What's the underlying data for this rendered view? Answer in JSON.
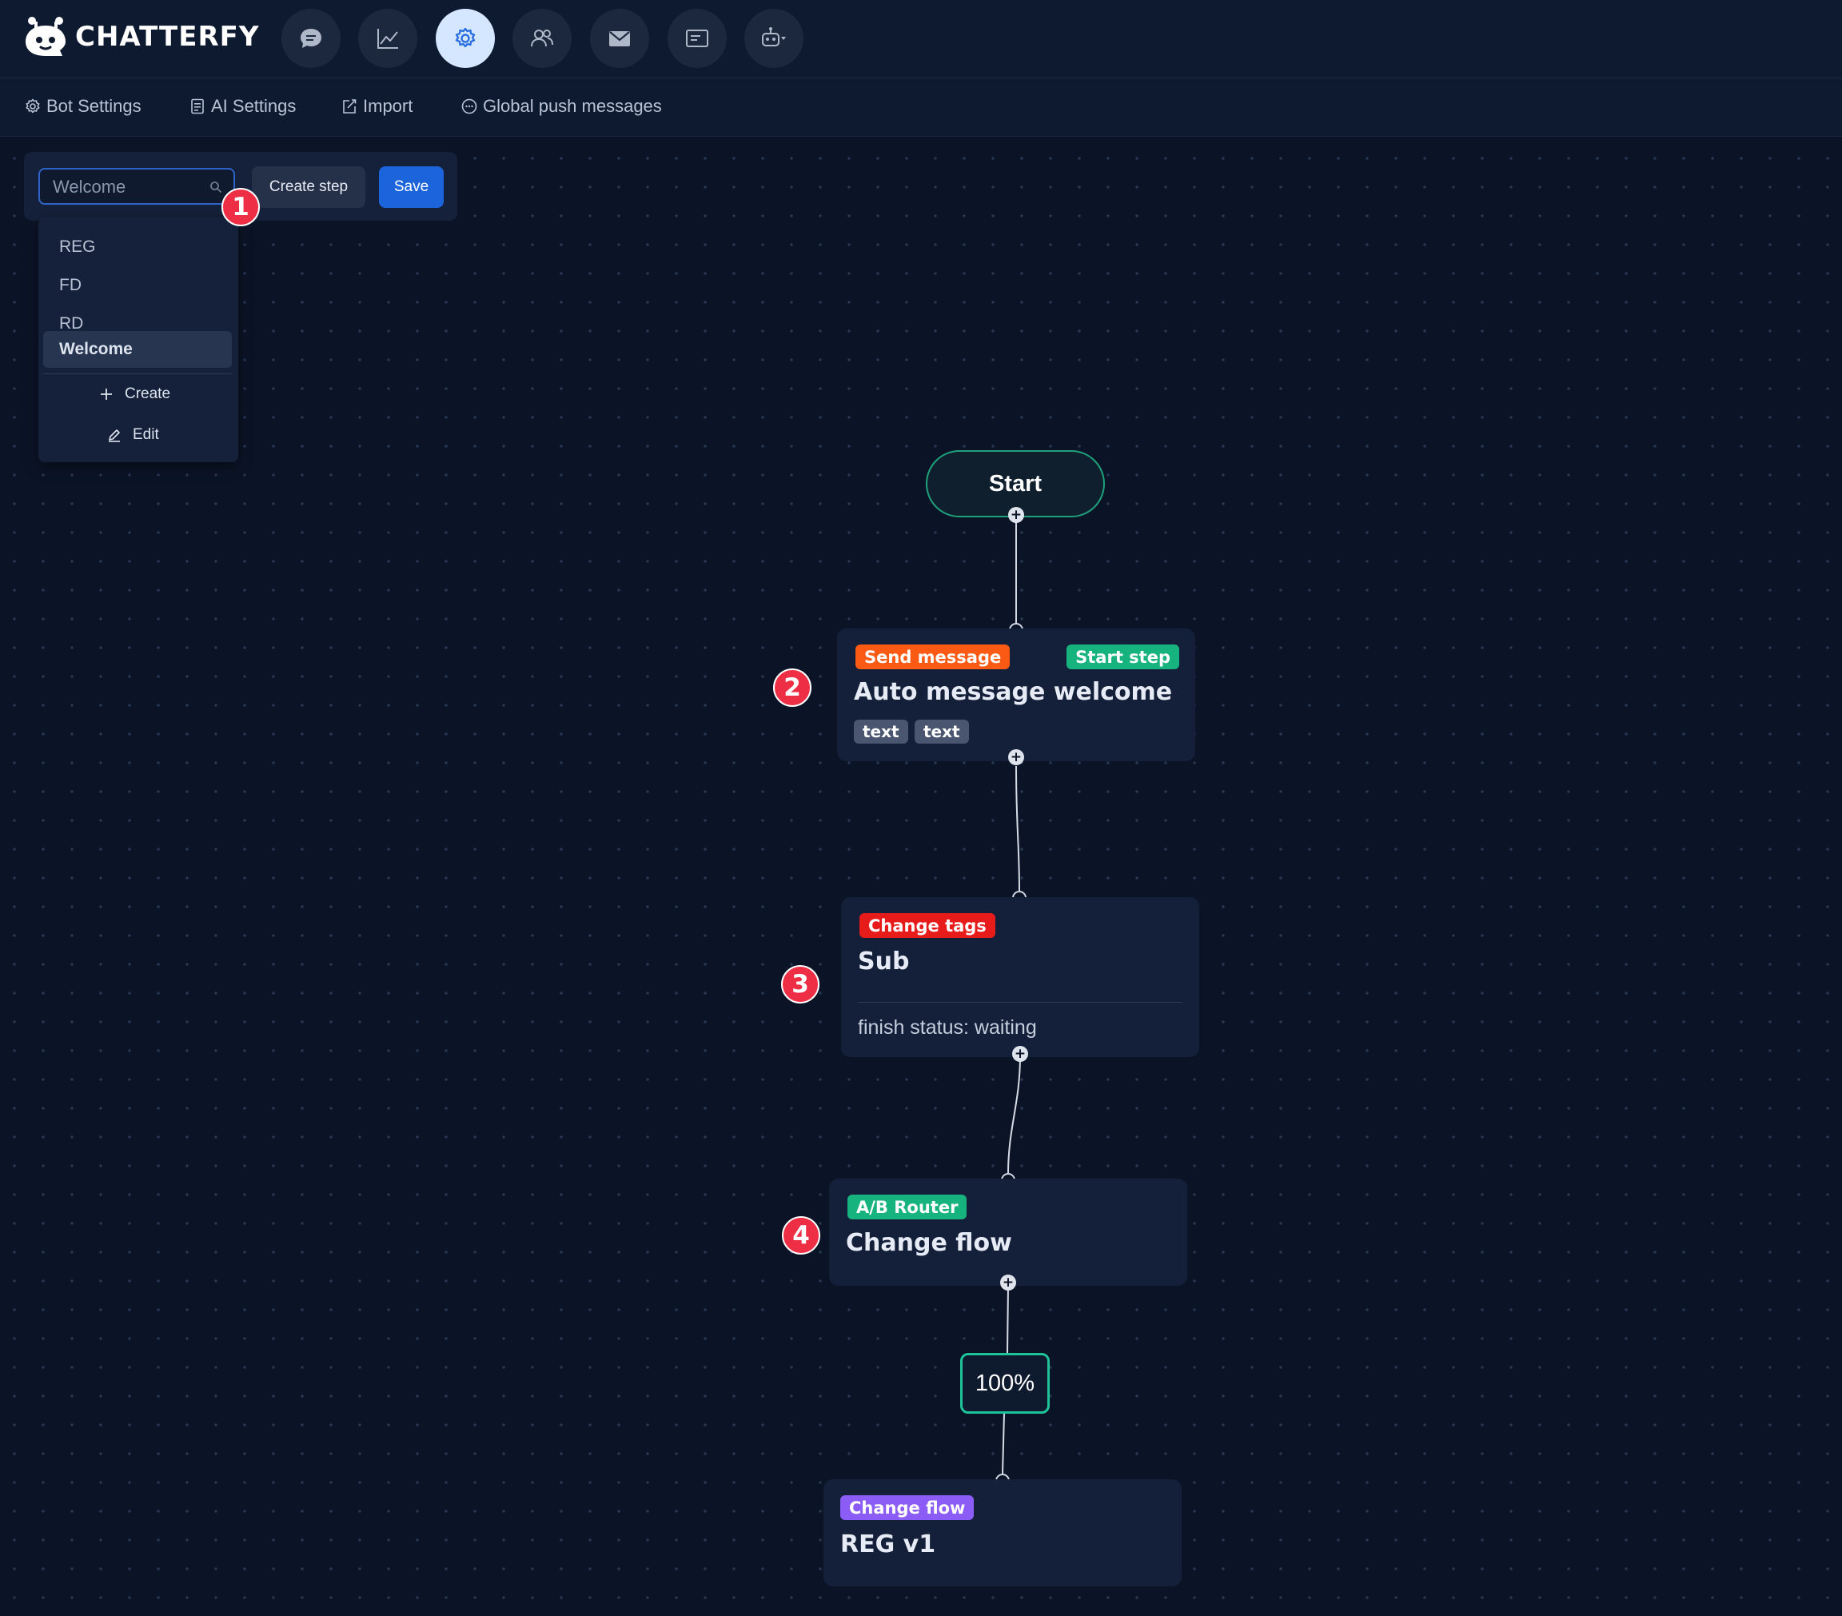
{
  "app": {
    "name": "CHATTERFY"
  },
  "nav": {
    "buttons": [
      {
        "icon": "chat-bubble-icon"
      },
      {
        "icon": "analytics-chart-icon"
      },
      {
        "icon": "settings-gear-icon",
        "active": true
      },
      {
        "icon": "users-icon"
      },
      {
        "icon": "mail-icon"
      },
      {
        "icon": "message-card-icon"
      },
      {
        "icon": "bot-dropdown-icon"
      }
    ]
  },
  "subnav": {
    "items": [
      {
        "label": "Bot Settings",
        "icon": "gear-icon"
      },
      {
        "label": "AI Settings",
        "icon": "document-icon"
      },
      {
        "label": "Import",
        "icon": "import-edit-icon"
      },
      {
        "label": "Global push messages",
        "icon": "message-dots-icon"
      }
    ]
  },
  "toolbar": {
    "search_value": "Welcome",
    "create_step_label": "Create step",
    "save_label": "Save"
  },
  "dropdown": {
    "items": [
      "REG",
      "FD",
      "RD",
      "Welcome"
    ],
    "selected": "Welcome",
    "create_label": "Create",
    "edit_label": "Edit"
  },
  "markers": [
    "1",
    "2",
    "3",
    "4"
  ],
  "flow": {
    "start_label": "Start",
    "nodes": [
      {
        "tag": "Send message",
        "tag_color": "#fa5a14",
        "badge": "Start step",
        "badge_color": "#17b37f",
        "title": "Auto message welcome",
        "chips": [
          "text",
          "text"
        ]
      },
      {
        "tag": "Change tags",
        "tag_color": "#e81b1b",
        "title": "Sub",
        "status": "finish status: waiting"
      },
      {
        "tag": "A/B Router",
        "tag_color": "#17b37f",
        "title": "Change flow"
      },
      {
        "tag": "Change flow",
        "tag_color": "#8b5cf6",
        "title": "REG v1"
      }
    ],
    "split_label": "100%"
  },
  "colors": {
    "background": "#0b1427",
    "accent_blue": "#1b64db",
    "marker_red": "#ee2e45",
    "router_green": "#1fc39a"
  }
}
